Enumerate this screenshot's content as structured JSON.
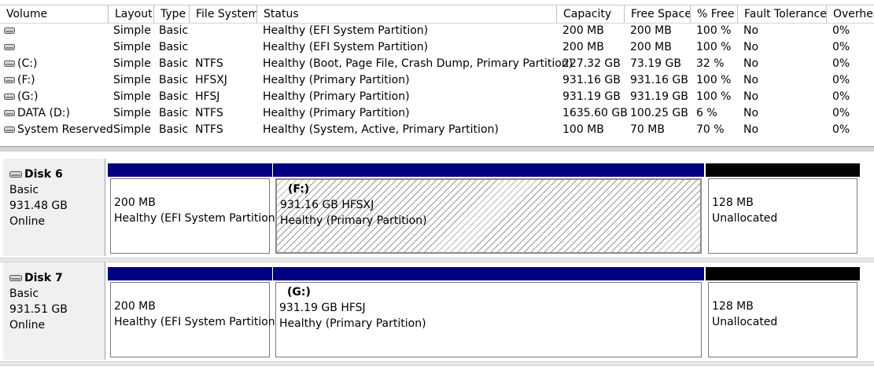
{
  "columns": [
    "Volume",
    "Layout",
    "Type",
    "File System",
    "Status",
    "Capacity",
    "Free Space",
    "% Free",
    "Fault Tolerance",
    "Overhea"
  ],
  "volumes": [
    {
      "volume": "",
      "layout": "Simple",
      "type": "Basic",
      "fs": "",
      "status": "Healthy (EFI System Partition)",
      "capacity": "200 MB",
      "free": "200 MB",
      "pct": "100 %",
      "fault": "No",
      "overhead": "0%"
    },
    {
      "volume": "",
      "layout": "Simple",
      "type": "Basic",
      "fs": "",
      "status": "Healthy (EFI System Partition)",
      "capacity": "200 MB",
      "free": "200 MB",
      "pct": "100 %",
      "fault": "No",
      "overhead": "0%"
    },
    {
      "volume": "(C:)",
      "layout": "Simple",
      "type": "Basic",
      "fs": "NTFS",
      "status": "Healthy (Boot, Page File, Crash Dump, Primary Partition)",
      "capacity": "227.32 GB",
      "free": "73.19 GB",
      "pct": "32 %",
      "fault": "No",
      "overhead": "0%"
    },
    {
      "volume": "(F:)",
      "layout": "Simple",
      "type": "Basic",
      "fs": "HFSXJ",
      "status": "Healthy (Primary Partition)",
      "capacity": "931.16 GB",
      "free": "931.16 GB",
      "pct": "100 %",
      "fault": "No",
      "overhead": "0%"
    },
    {
      "volume": "(G:)",
      "layout": "Simple",
      "type": "Basic",
      "fs": "HFSJ",
      "status": "Healthy (Primary Partition)",
      "capacity": "931.19 GB",
      "free": "931.19 GB",
      "pct": "100 %",
      "fault": "No",
      "overhead": "0%"
    },
    {
      "volume": "DATA (D:)",
      "layout": "Simple",
      "type": "Basic",
      "fs": "NTFS",
      "status": "Healthy (Primary Partition)",
      "capacity": "1635.60 GB",
      "free": "100.25 GB",
      "pct": "6 %",
      "fault": "No",
      "overhead": "0%"
    },
    {
      "volume": "System Reserved",
      "layout": "Simple",
      "type": "Basic",
      "fs": "NTFS",
      "status": "Healthy (System, Active, Primary Partition)",
      "capacity": "100 MB",
      "free": "70 MB",
      "pct": "70 %",
      "fault": "No",
      "overhead": "0%"
    }
  ],
  "disks": [
    {
      "name": "Disk 6",
      "type": "Basic",
      "size": "931.48 GB",
      "state": "Online",
      "partitions": [
        {
          "title": "",
          "size": "200 MB",
          "status": "Healthy (EFI System Partition)",
          "band": "primary"
        },
        {
          "title": "(F:)",
          "size": "931.16 GB HFSXJ",
          "status": "Healthy (Primary Partition)",
          "band": "primary",
          "selected": true
        },
        {
          "title": "",
          "size": "128 MB",
          "status": "Unallocated",
          "band": "unallocated"
        }
      ]
    },
    {
      "name": "Disk 7",
      "type": "Basic",
      "size": "931.51 GB",
      "state": "Online",
      "partitions": [
        {
          "title": "",
          "size": "200 MB",
          "status": "Healthy (EFI System Partition)",
          "band": "primary"
        },
        {
          "title": "(G:)",
          "size": "931.19 GB HFSJ",
          "status": "Healthy (Primary Partition)",
          "band": "primary"
        },
        {
          "title": "",
          "size": "128 MB",
          "status": "Unallocated",
          "band": "unallocated"
        }
      ]
    }
  ],
  "colors": {
    "primary_band": "#000080",
    "unallocated_band": "#000000",
    "selection_hatch": "#9a9a9a"
  },
  "icons": {
    "volume": "drive-icon",
    "disk": "disk-icon"
  }
}
